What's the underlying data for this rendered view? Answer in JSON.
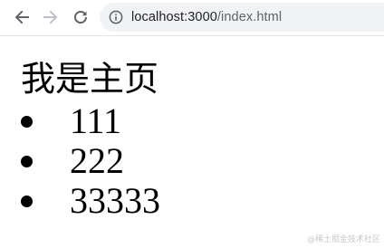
{
  "browser": {
    "url_host": "localhost:3000",
    "url_path": "/index.html",
    "icons": {
      "back": "arrow-left-icon",
      "forward": "arrow-right-icon",
      "reload": "reload-icon",
      "site_info": "info-icon"
    },
    "colors": {
      "icon_active": "#5f6368",
      "icon_disabled": "#bdc1c6",
      "address_bg": "#f1f3f4"
    }
  },
  "page": {
    "title": "我是主页",
    "items": [
      "111",
      "222",
      "33333"
    ]
  },
  "watermark": "@稀土掘金技术社区"
}
